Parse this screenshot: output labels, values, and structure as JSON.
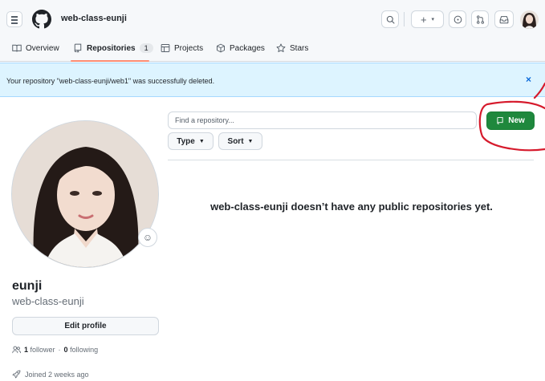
{
  "header": {
    "owner": "web-class-eunji",
    "icons": [
      "menu-icon",
      "github-logo",
      "search-icon",
      "plus-icon",
      "issues-icon",
      "pull-requests-icon",
      "inbox-icon"
    ]
  },
  "nav": {
    "overview": "Overview",
    "repositories": "Repositories",
    "repositories_count": "1",
    "projects": "Projects",
    "packages": "Packages",
    "stars": "Stars"
  },
  "flash": {
    "message": "Your repository \"web-class-eunji/web1\" was successfully deleted.",
    "close": "×"
  },
  "profile": {
    "name": "eunji",
    "login": "web-class-eunji",
    "edit_label": "Edit profile",
    "followers_count": "1",
    "followers_label": "follower",
    "dot": "·",
    "following_count": "0",
    "following_label": "following",
    "joined": "Joined 2 weeks ago"
  },
  "repos": {
    "search_placeholder": "Find a repository...",
    "type_label": "Type",
    "sort_label": "Sort",
    "new_label": "New",
    "empty_message": "web-class-eunji doesn’t have any public repositories yet."
  },
  "colors": {
    "accent_green": "#1f883d",
    "flash_bg": "#ddf4ff",
    "annotation_red": "#d61a2c",
    "nav_underline": "#fd8c73"
  }
}
